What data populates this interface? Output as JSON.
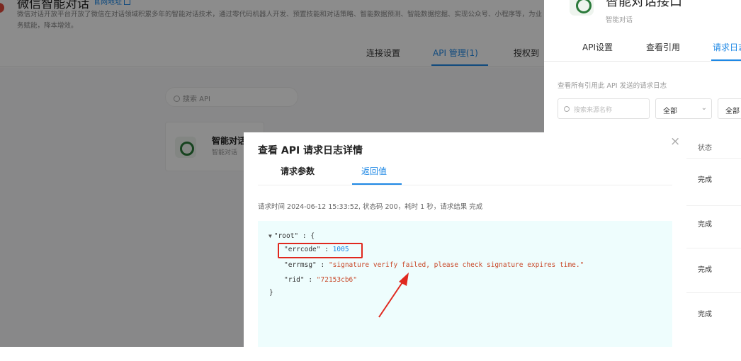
{
  "header": {
    "app_title": "微信智能对话",
    "official_link": "官网地址",
    "description": "微信对话开放平台开放了微信在对话领域积累多年的智能对话技术，通过零代码机器人开发、预置技能和对话策略、智能数据预测、智能数据挖掘、实现公众号、小程序等，为业务赋能，降本增效。",
    "tabs": [
      {
        "label": "连接设置"
      },
      {
        "label": "API 管理(1)"
      },
      {
        "label": "授权到"
      }
    ]
  },
  "main": {
    "search_placeholder": "搜索 API",
    "api_card": {
      "title": "智能对话",
      "subtitle": "智能对话"
    }
  },
  "drawer": {
    "title": "智能对话接口",
    "subtitle": "智能对话",
    "tabs": [
      {
        "label": "API设置"
      },
      {
        "label": "查看引用"
      },
      {
        "label": "请求日志"
      }
    ],
    "hint": "查看所有引用此 API 发送的请求日志",
    "search_placeholder": "搜索来源名称",
    "filter1": "全部",
    "filter2": "全部",
    "column_status": "状态",
    "rows": [
      {
        "status": "完成"
      },
      {
        "status": "完成"
      },
      {
        "status": "完成"
      },
      {
        "status": "完成"
      }
    ]
  },
  "modal": {
    "title": "查看 API 请求日志详情",
    "close": "×",
    "tabs": [
      {
        "label": "请求参数"
      },
      {
        "label": "返回值"
      }
    ],
    "info": "请求时间 2024-06-12 15:33:52, 状态码 200，耗时 1 秒，请求结果 完成",
    "response": {
      "root_key": "\"root\"",
      "errcode_key": "\"errcode\"",
      "errcode_value": "1005",
      "errmsg_key": "\"errmsg\"",
      "errmsg_value": "\"signature verify failed, please check signature expires time.\"",
      "rid_key": "\"rid\"",
      "rid_value": "\"72153cb6\""
    }
  },
  "colors": {
    "accent": "#1e88e5",
    "highlight_red": "#e0281e",
    "code_bg": "#eefdfd",
    "string_color": "#c94a2b"
  }
}
